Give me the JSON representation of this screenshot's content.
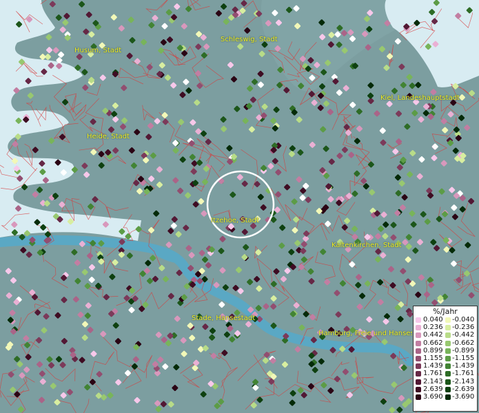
{
  "colors": {
    "sea": "#d8ecf2",
    "land": "#7c9ea0",
    "river": "#5aa8c4",
    "border": "#d83a3a",
    "label": "#f2ee22"
  },
  "cities": [
    {
      "id": "husum",
      "name": "Husum, Stadt"
    },
    {
      "id": "schleswig",
      "name": "Schleswig, Stadt"
    },
    {
      "id": "kiel",
      "name": "Kiel, Landeshauptstadt"
    },
    {
      "id": "heide",
      "name": "Heide, Stadt"
    },
    {
      "id": "itzehoe",
      "name": "Itzehoe, Stadt"
    },
    {
      "id": "kaltenkirchen",
      "name": "Kaltenkirchen, Stadt"
    },
    {
      "id": "stade",
      "name": "Stade, Hansestadt"
    },
    {
      "id": "hamburg",
      "name": "Hamburg, Freie und Hansestadt"
    }
  ],
  "legend": {
    "title": "%/Jahr",
    "positive": [
      {
        "label": "0.040",
        "color": "#f7c8ea"
      },
      {
        "label": "0.236",
        "color": "#eab0d4"
      },
      {
        "label": "0.442",
        "color": "#d898bc"
      },
      {
        "label": "0.662",
        "color": "#c27ea2"
      },
      {
        "label": "0.899",
        "color": "#aa6488"
      },
      {
        "label": "1.155",
        "color": "#924e70"
      },
      {
        "label": "1.439",
        "color": "#7c3a5a"
      },
      {
        "label": "1.761",
        "color": "#662846"
      },
      {
        "label": "2.143",
        "color": "#521834"
      },
      {
        "label": "2.639",
        "color": "#3e0c22"
      },
      {
        "label": "3.690",
        "color": "#2a0414"
      }
    ],
    "negative": [
      {
        "label": "-0.040",
        "color": "#f2f8b8"
      },
      {
        "label": "-0.236",
        "color": "#d8eea0"
      },
      {
        "label": "-0.442",
        "color": "#b8dc88"
      },
      {
        "label": "-0.662",
        "color": "#98c870"
      },
      {
        "label": "-0.899",
        "color": "#78b45a"
      },
      {
        "label": "-1.155",
        "color": "#5c9c46"
      },
      {
        "label": "-1.439",
        "color": "#428434"
      },
      {
        "label": "-1.761",
        "color": "#2e6c26"
      },
      {
        "label": "-2.143",
        "color": "#1c561a"
      },
      {
        "label": "-2.639",
        "color": "#0e4010"
      },
      {
        "label": "-3.690",
        "color": "#042a08"
      }
    ]
  }
}
